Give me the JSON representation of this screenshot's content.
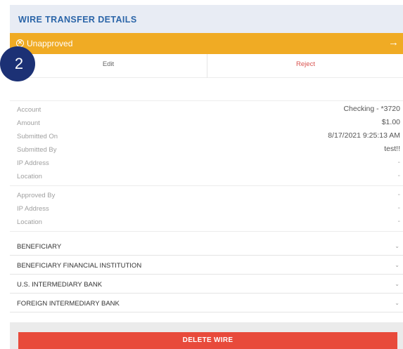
{
  "header": {
    "title": "WIRE TRANSFER DETAILS"
  },
  "status": {
    "label": "Unapproved",
    "icon": "close-circle-icon",
    "arrow_icon": "arrow-right-icon",
    "color": "#f0ab24"
  },
  "step_badge": "2",
  "actions": {
    "edit": "Edit",
    "reject": "Reject"
  },
  "details": [
    {
      "label": "Account",
      "value": "Checking - *3720"
    },
    {
      "label": "Amount",
      "value": "$1.00"
    },
    {
      "label": "Submitted On",
      "value": "8/17/2021 9:25:13 AM"
    },
    {
      "label": "Submitted By",
      "value": "test!!"
    },
    {
      "label": "IP Address",
      "value": "-"
    },
    {
      "label": "Location",
      "value": "-"
    }
  ],
  "approval": [
    {
      "label": "Approved By",
      "value": "-"
    },
    {
      "label": "IP Address",
      "value": "-"
    },
    {
      "label": "Location",
      "value": "-"
    }
  ],
  "sections": [
    {
      "title": "BENEFICIARY"
    },
    {
      "title": "BENEFICIARY FINANCIAL INSTITUTION"
    },
    {
      "title": "U.S. INTERMEDIARY BANK"
    },
    {
      "title": "FOREIGN INTERMEDIARY BANK"
    }
  ],
  "delete_label": "DELETE WIRE",
  "colors": {
    "header_text": "#2b65a8",
    "reject": "#d9534f",
    "delete": "#e84a3b",
    "badge": "#1c3175"
  }
}
